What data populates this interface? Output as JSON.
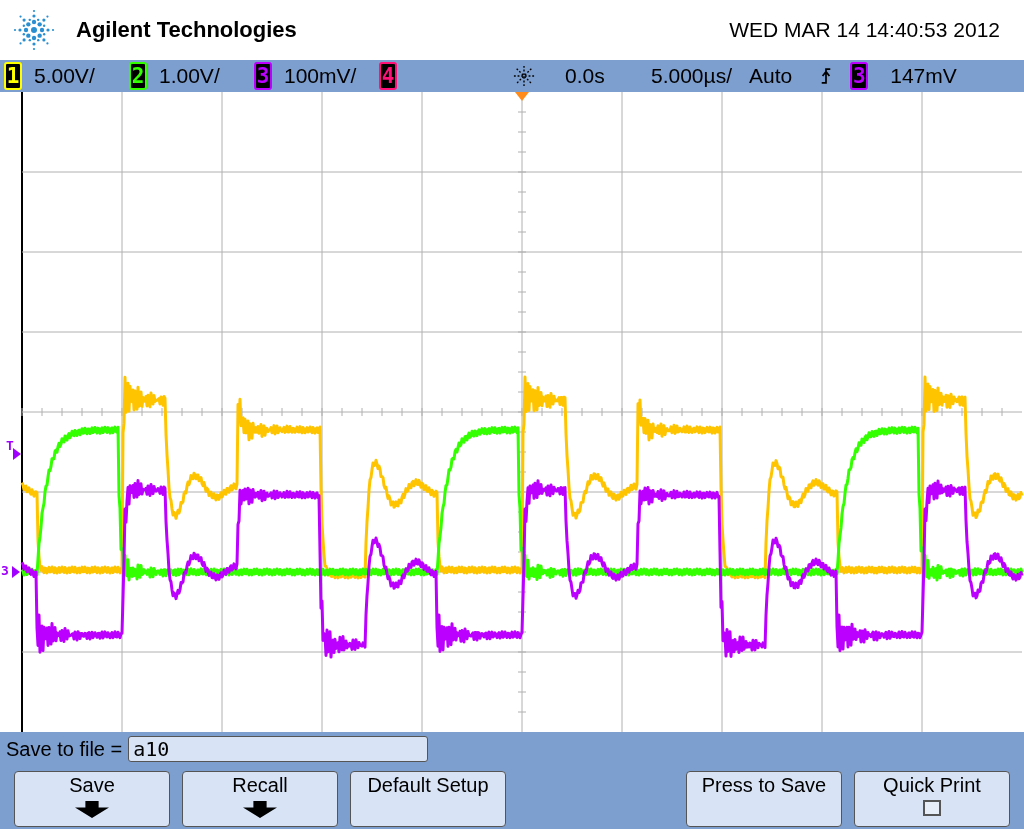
{
  "header": {
    "brand": "Agilent Technologies",
    "datetime": "WED MAR 14 14:40:53 2012"
  },
  "status_bar": {
    "channels": [
      {
        "number": "1",
        "color": "#ffff00",
        "scale": "5.00V/"
      },
      {
        "number": "2",
        "color": "#33ff00",
        "scale": "1.00V/"
      },
      {
        "number": "3",
        "color": "#bb00ff",
        "scale": "100mV/"
      },
      {
        "number": "4",
        "color": "#ff1177"
      }
    ],
    "delay": "0.0s",
    "timebase": "5.000µs/",
    "trigger_mode": "Auto",
    "trigger_source": {
      "number": "3",
      "color": "#bb00ff"
    },
    "trigger_level": "147mV"
  },
  "display": {
    "trigger_marker": "T",
    "ground_marker": "3"
  },
  "save_bar": {
    "label": "Save to file =",
    "value": "a10"
  },
  "softkeys_left": [
    {
      "label": "Save",
      "kind": "arrow"
    },
    {
      "label": "Recall",
      "kind": "arrow"
    },
    {
      "label": "Default Setup",
      "kind": "plain"
    }
  ],
  "softkeys_right": [
    {
      "label": "Press to Save",
      "kind": "plain"
    },
    {
      "label": "Quick Print",
      "kind": "checkbox",
      "checked": false
    }
  ]
}
